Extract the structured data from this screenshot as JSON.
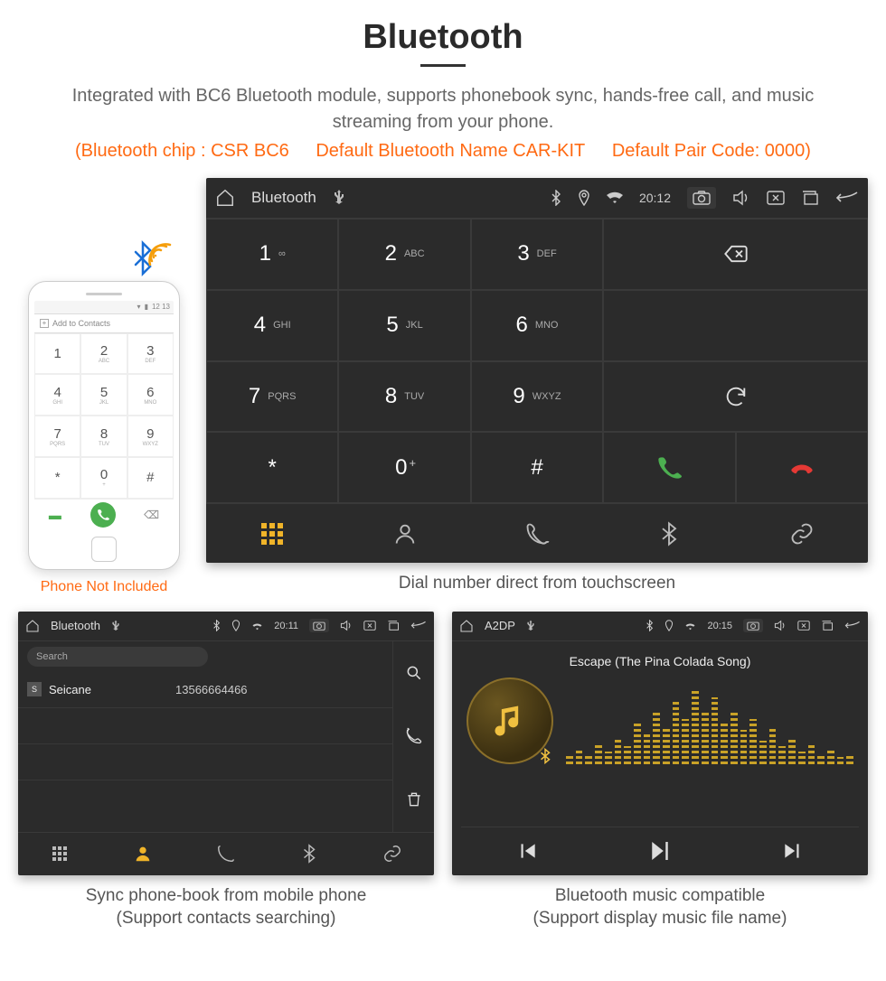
{
  "header": {
    "title": "Bluetooth",
    "subtitle": "Integrated with BC6 Bluetooth module, supports phonebook sync, hands-free call, and music streaming from your phone.",
    "spec_chip": "(Bluetooth chip : CSR BC6",
    "spec_name": "Default Bluetooth Name CAR-KIT",
    "spec_code": "Default Pair Code: 0000)"
  },
  "phone_mock": {
    "statusbar_time": "12 13",
    "add_contacts": "Add to Contacts",
    "keypad": [
      {
        "d": "1",
        "l": ""
      },
      {
        "d": "2",
        "l": "ABC"
      },
      {
        "d": "3",
        "l": "DEF"
      },
      {
        "d": "4",
        "l": "GHI"
      },
      {
        "d": "5",
        "l": "JKL"
      },
      {
        "d": "6",
        "l": "MNO"
      },
      {
        "d": "7",
        "l": "PQRS"
      },
      {
        "d": "8",
        "l": "TUV"
      },
      {
        "d": "9",
        "l": "WXYZ"
      },
      {
        "d": "*",
        "l": ""
      },
      {
        "d": "0",
        "l": "+"
      },
      {
        "d": "#",
        "l": ""
      }
    ],
    "not_included": "Phone Not Included"
  },
  "dialer_panel": {
    "status": {
      "title": "Bluetooth",
      "time": "20:12"
    },
    "keypad": [
      {
        "d": "1",
        "l": "∞"
      },
      {
        "d": "2",
        "l": "ABC"
      },
      {
        "d": "3",
        "l": "DEF"
      },
      {
        "d": "4",
        "l": "GHI"
      },
      {
        "d": "5",
        "l": "JKL"
      },
      {
        "d": "6",
        "l": "MNO"
      },
      {
        "d": "7",
        "l": "PQRS"
      },
      {
        "d": "8",
        "l": "TUV"
      },
      {
        "d": "9",
        "l": "WXYZ"
      },
      {
        "d": "*",
        "l": ""
      },
      {
        "d": "0",
        "l": "",
        "plus": "+"
      },
      {
        "d": "#",
        "l": ""
      }
    ],
    "caption": "Dial number direct from touchscreen"
  },
  "phonebook_panel": {
    "status": {
      "title": "Bluetooth",
      "time": "20:11"
    },
    "search_placeholder": "Search",
    "contacts": [
      {
        "badge": "S",
        "name": "Seicane",
        "number": "13566664466"
      }
    ],
    "caption_line1": "Sync phone-book from mobile phone",
    "caption_line2": "(Support contacts searching)"
  },
  "music_panel": {
    "status": {
      "title": "A2DP",
      "time": "20:15"
    },
    "track": "Escape (The Pina Colada Song)",
    "viz_heights": [
      12,
      18,
      10,
      22,
      14,
      30,
      20,
      46,
      34,
      58,
      42,
      70,
      50,
      82,
      60,
      74,
      48,
      60,
      38,
      50,
      26,
      40,
      20,
      30,
      14,
      22,
      10,
      16,
      8,
      12
    ],
    "caption_line1": "Bluetooth music compatible",
    "caption_line2": "(Support display music file name)"
  }
}
